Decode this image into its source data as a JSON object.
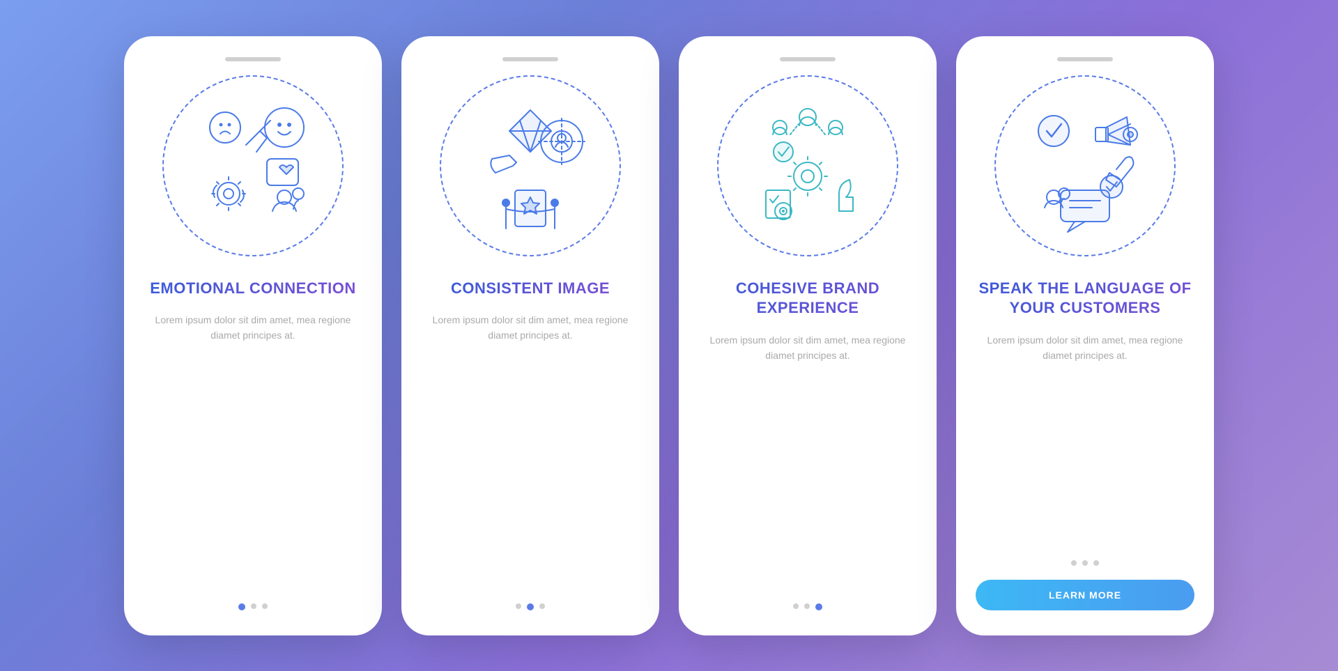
{
  "background": {
    "gradient_start": "#7b9ef0",
    "gradient_end": "#a78bd4"
  },
  "cards": [
    {
      "id": "card-1",
      "title": "EMOTIONAL CONNECTION",
      "body": "Lorem ipsum dolor sit dim amet, mea regione diamet principes at.",
      "dots": [
        true,
        false,
        false
      ],
      "has_button": false,
      "button_label": ""
    },
    {
      "id": "card-2",
      "title": "CONSISTENT IMAGE",
      "body": "Lorem ipsum dolor sit dim amet, mea regione diamet principes at.",
      "dots": [
        false,
        true,
        false
      ],
      "has_button": false,
      "button_label": ""
    },
    {
      "id": "card-3",
      "title": "COHESIVE BRAND EXPERIENCE",
      "body": "Lorem ipsum dolor sit dim amet, mea regione diamet principes at.",
      "dots": [
        false,
        false,
        true
      ],
      "has_button": false,
      "button_label": ""
    },
    {
      "id": "card-4",
      "title": "SPEAK THE LANGUAGE OF YOUR CUSTOMERS",
      "body": "Lorem ipsum dolor sit dim amet, mea regione diamet principes at.",
      "dots": [
        false,
        false,
        false
      ],
      "has_button": true,
      "button_label": "LEARN MORE"
    }
  ]
}
